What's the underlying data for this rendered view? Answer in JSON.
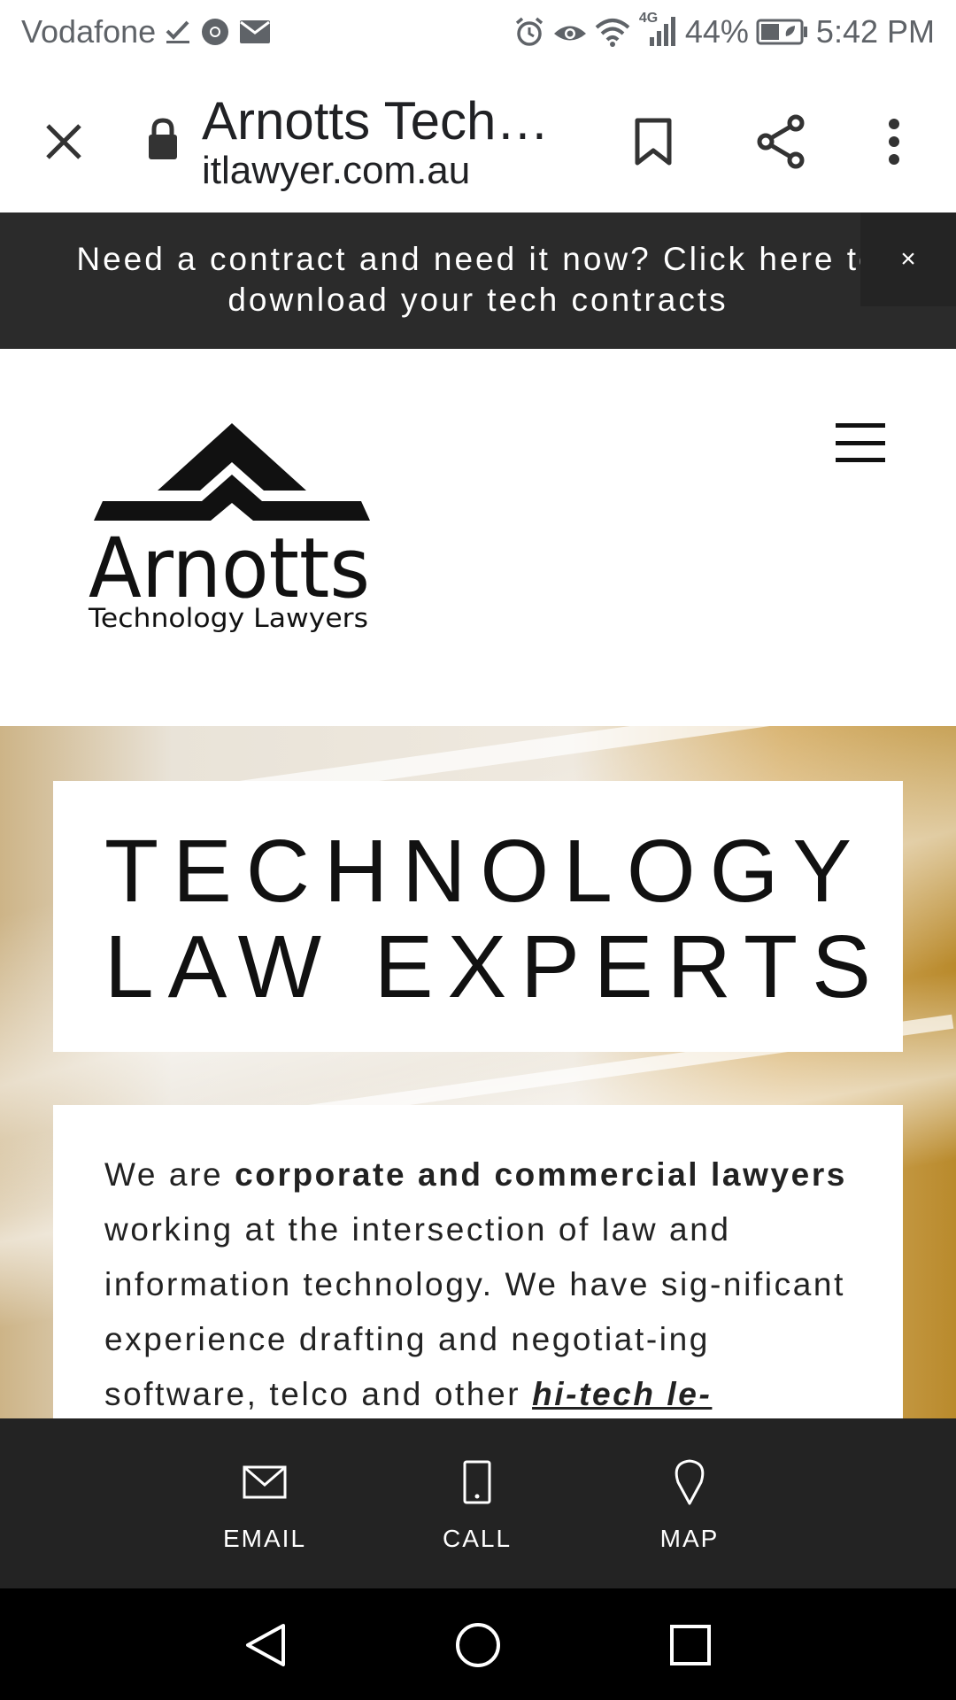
{
  "status_bar": {
    "carrier": "Vodafone",
    "battery_percent": "44%",
    "time": "5:42 PM",
    "network": "4G",
    "icons": [
      "check-icon",
      "chrome-icon",
      "mail-icon",
      "alarm-icon",
      "eye-icon",
      "wifi-icon",
      "signal-icon",
      "battery-icon"
    ]
  },
  "toolbar": {
    "page_title": "Arnotts Tech…",
    "url": "itlawyer.com.au"
  },
  "banner": {
    "text": "Need a contract and need it now? Click here to download your tech contracts",
    "close_glyph": "×"
  },
  "logo": {
    "name": "Arnotts",
    "tagline": "Technology Lawyers"
  },
  "hero": {
    "title_line1": "TECHNOLOGY",
    "title_line2": "LAW EXPERTS",
    "para_1": "We are ",
    "para_bold": "corporate and commercial lawyers",
    "para_2": " working at the intersection of law and information technology. We have sig-nificant experience drafting and negotiat-ing software, telco and other ",
    "para_link": "hi-tech le-"
  },
  "contact_bar": {
    "email_label": "EMAIL",
    "call_label": "CALL",
    "map_label": "MAP"
  },
  "colors": {
    "banner_bg": "#2b2b2b",
    "contact_bar_bg": "#232323",
    "nav_bg": "#000000",
    "status_text": "#5f6368"
  }
}
